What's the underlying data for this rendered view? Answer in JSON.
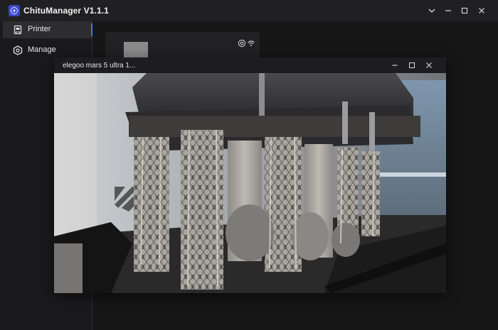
{
  "app": {
    "title": "ChituManager V1.1.1"
  },
  "sidebar": {
    "items": [
      {
        "label": "Printer",
        "active": true
      },
      {
        "label": "Manage",
        "active": false
      }
    ]
  },
  "camera_window": {
    "title": "elegoo mars 5 ultra 1..."
  },
  "colors": {
    "accent": "#3a7be0",
    "logo": "#3b46c9"
  }
}
